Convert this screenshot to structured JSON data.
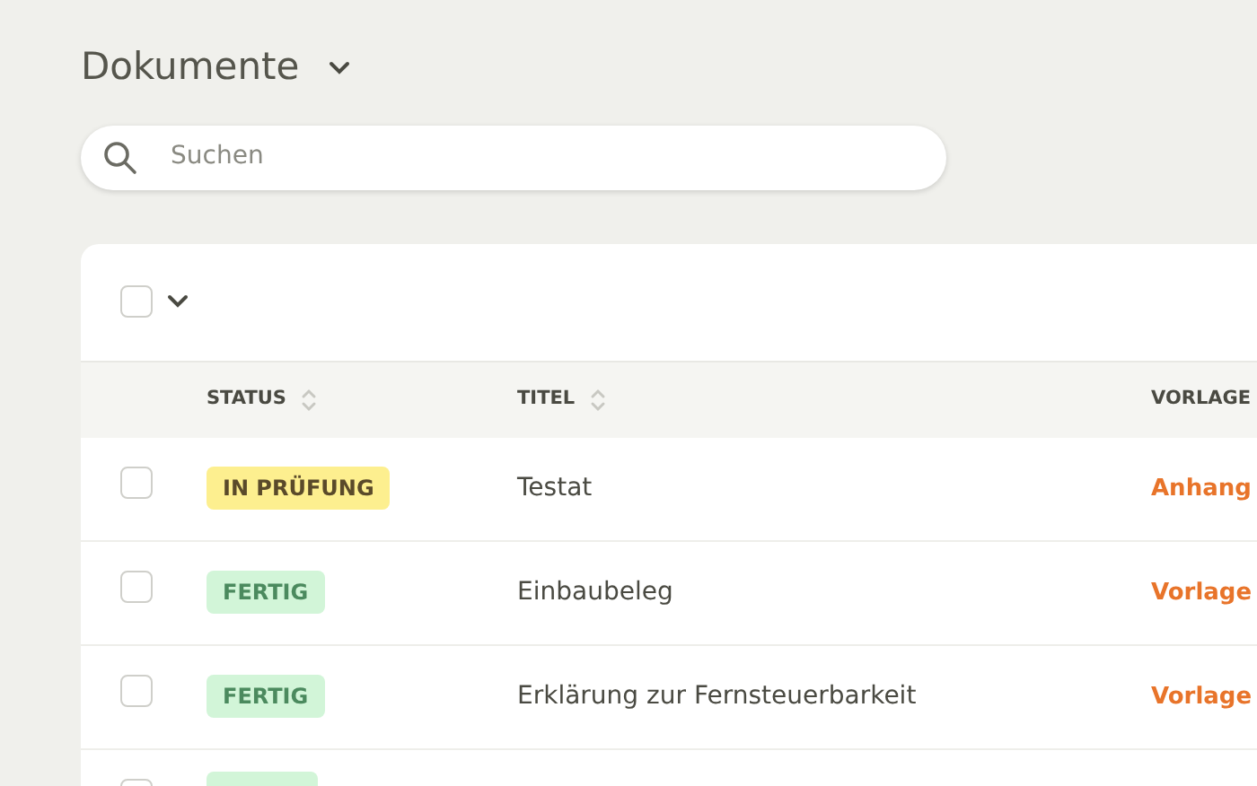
{
  "header": {
    "title": "Dokumente"
  },
  "search": {
    "placeholder": "Suchen"
  },
  "toolbar": {
    "select_all_checked": false
  },
  "table": {
    "columns": [
      {
        "label": "STATUS",
        "sortable": true
      },
      {
        "label": "TITEL",
        "sortable": true
      },
      {
        "label": "VORLAGE",
        "sortable": false
      }
    ],
    "rows": [
      {
        "checked": false,
        "status": {
          "label": "IN PRÜFUNG",
          "kind": "review"
        },
        "title": "Testat",
        "type": "Anhang"
      },
      {
        "checked": false,
        "status": {
          "label": "FERTIG",
          "kind": "done"
        },
        "title": "Einbaubeleg",
        "type": "Vorlage"
      },
      {
        "checked": false,
        "status": {
          "label": "FERTIG",
          "kind": "done"
        },
        "title": "Erklärung zur Fernsteuerbarkeit",
        "type": "Vorlage"
      },
      {
        "checked": false,
        "status": {
          "kind": "done"
        }
      }
    ]
  }
}
